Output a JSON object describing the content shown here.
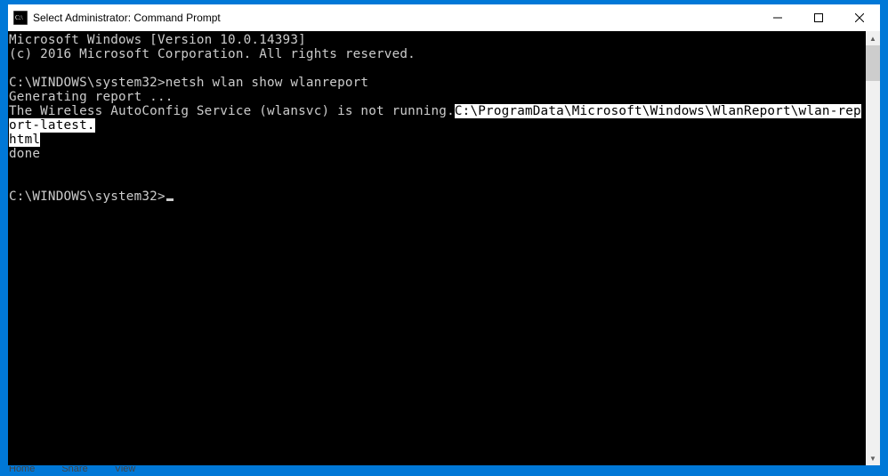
{
  "window": {
    "title": "Select Administrator: Command Prompt"
  },
  "terminal": {
    "header_line1": "Microsoft Windows [Version 10.0.14393]",
    "header_line2": "(c) 2016 Microsoft Corporation. All rights reserved.",
    "prompt1_path": "C:\\WINDOWS\\system32>",
    "prompt1_cmd": "netsh wlan show wlanreport",
    "output_line1": "Generating report ...",
    "output_line2_pre": "The Wireless AutoConfig Service (wlansvc) is not running.",
    "output_line2_sel_a": "C:\\ProgramData\\Microsoft\\Windows\\WlanReport\\wlan-report-latest.",
    "output_line2_sel_b": "html",
    "output_line3": "done",
    "prompt2_path": "C:\\WINDOWS\\system32>"
  },
  "behind": {
    "tab1": "Home",
    "tab2": "Share",
    "tab3": "View"
  }
}
